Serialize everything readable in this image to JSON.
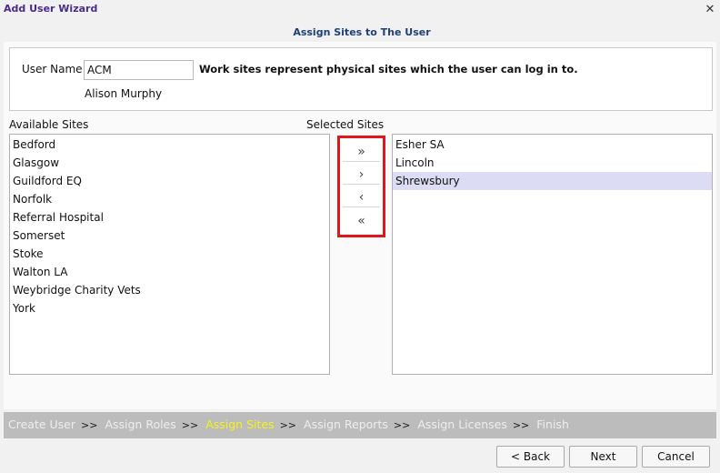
{
  "window": {
    "title": "Add User Wizard",
    "close_glyph": "✕"
  },
  "step_title": "Assign Sites to The User",
  "user": {
    "username_label": "User Name",
    "username_value": "ACM",
    "note": "Work sites represent physical sites which the user can log in to.",
    "full_name": "Alison Murphy"
  },
  "available": {
    "label": "Available Sites",
    "items": [
      "Bedford",
      "Glasgow",
      "Guildford EQ",
      "Norfolk",
      "Referral Hospital",
      "Somerset",
      "Stoke",
      "Walton LA",
      "Weybridge Charity Vets",
      "York"
    ]
  },
  "selected": {
    "label": "Selected Sites",
    "items": [
      "Esher SA",
      "Lincoln",
      "Shrewsbury"
    ],
    "highlighted_index": 2
  },
  "transfer": {
    "add_all": "»",
    "add_one": "›",
    "remove_one": "‹",
    "remove_all": "«"
  },
  "wizard_steps": {
    "separator": ">>",
    "current_index": 2,
    "items": [
      "Create User",
      "Assign Roles",
      "Assign Sites",
      "Assign Reports",
      "Assign Licenses",
      "Finish"
    ]
  },
  "buttons": {
    "back": "< Back",
    "next": "Next",
    "cancel": "Cancel"
  },
  "colors": {
    "title": "#4a2a8c",
    "step_title": "#1f3f7a",
    "highlight_frame": "#e0161c",
    "current_step": "#f7f21c",
    "selected_row": "#dcdcf4"
  }
}
